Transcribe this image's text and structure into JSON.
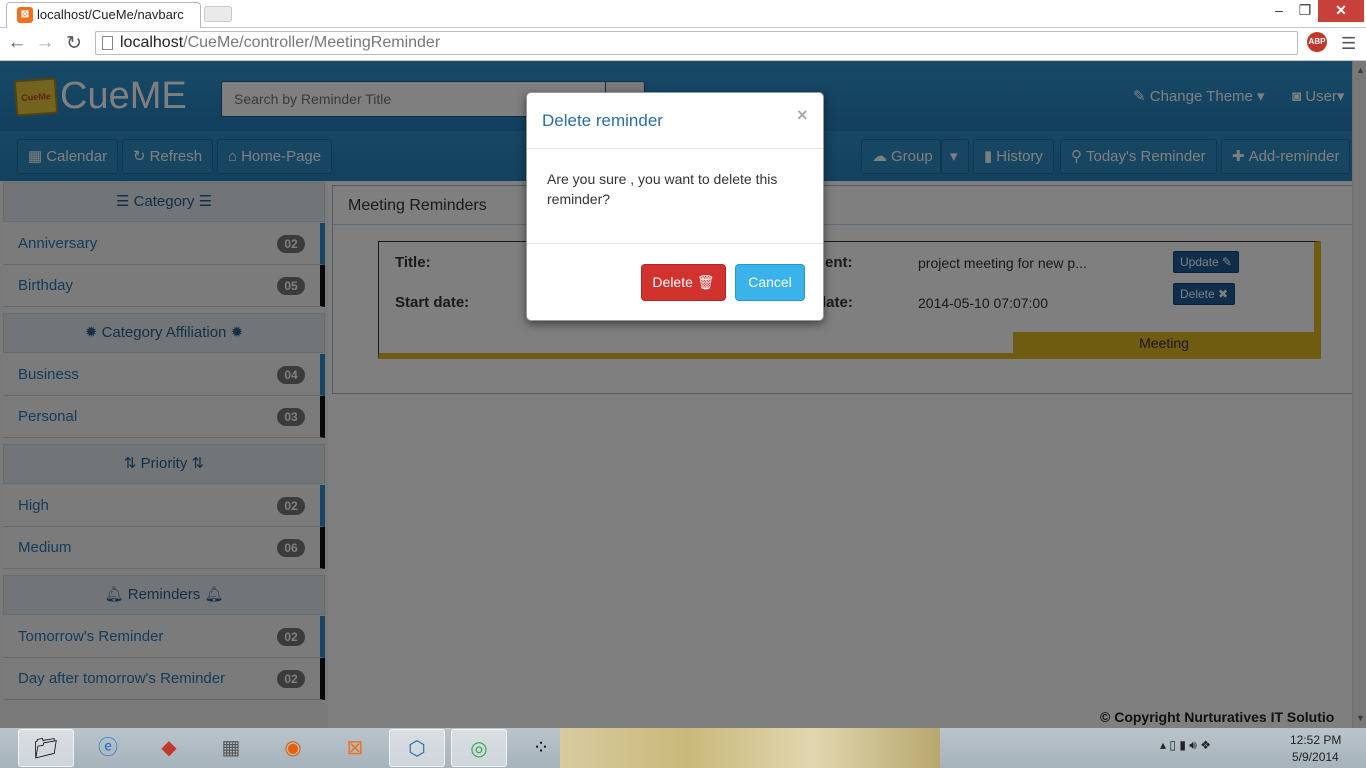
{
  "browser": {
    "tab_title": "localhost/CueMe/navbarc",
    "url_host": "localhost",
    "url_path": "/CueMe/controller/MeetingReminder"
  },
  "app": {
    "brand": "CueME",
    "logo_text": "CueMe",
    "search_placeholder": "Search by Reminder Title",
    "change_theme": "Change Theme",
    "user": "User"
  },
  "subnav": {
    "calendar": "Calendar",
    "refresh": "Refresh",
    "home": "Home-Page",
    "group": "Group",
    "history": "History",
    "today": "Today's Reminder",
    "add": "Add-reminder"
  },
  "sidebar": {
    "category_head": "Category",
    "category_items": [
      {
        "label": "Anniversary",
        "count": "02"
      },
      {
        "label": "Birthday",
        "count": "05"
      }
    ],
    "affiliation_head": "Category Affiliation",
    "affiliation_items": [
      {
        "label": "Business",
        "count": "04"
      },
      {
        "label": "Personal",
        "count": "03"
      }
    ],
    "priority_head": "Priority",
    "priority_items": [
      {
        "label": "High",
        "count": "02"
      },
      {
        "label": "Medium",
        "count": "06"
      }
    ],
    "reminders_head": "Reminders",
    "reminder_items": [
      {
        "label": "Tomorrow's Reminder",
        "count": "02"
      },
      {
        "label": "Day after tomorrow's Reminder",
        "count": "02"
      }
    ]
  },
  "content": {
    "title": "Meeting Reminders",
    "title_label": "Title:",
    "start_label": "Start date:",
    "event_label_partial": "ent:",
    "date_label_partial": "date:",
    "event_value": "project meeting for new p...",
    "date_value": "2014-05-10 07:07:00",
    "update_btn": "Update",
    "delete_btn": "Delete",
    "group_tag": "Meeting"
  },
  "modal": {
    "title": "Delete reminder",
    "close": "×",
    "body": "Are you sure , you want to delete this reminder?",
    "delete": "Delete",
    "cancel": "Cancel"
  },
  "footer": {
    "copyright": "Copyright Nurturatives IT Solutio"
  },
  "taskbar": {
    "time": "12:52 PM",
    "date": "5/9/2014"
  }
}
